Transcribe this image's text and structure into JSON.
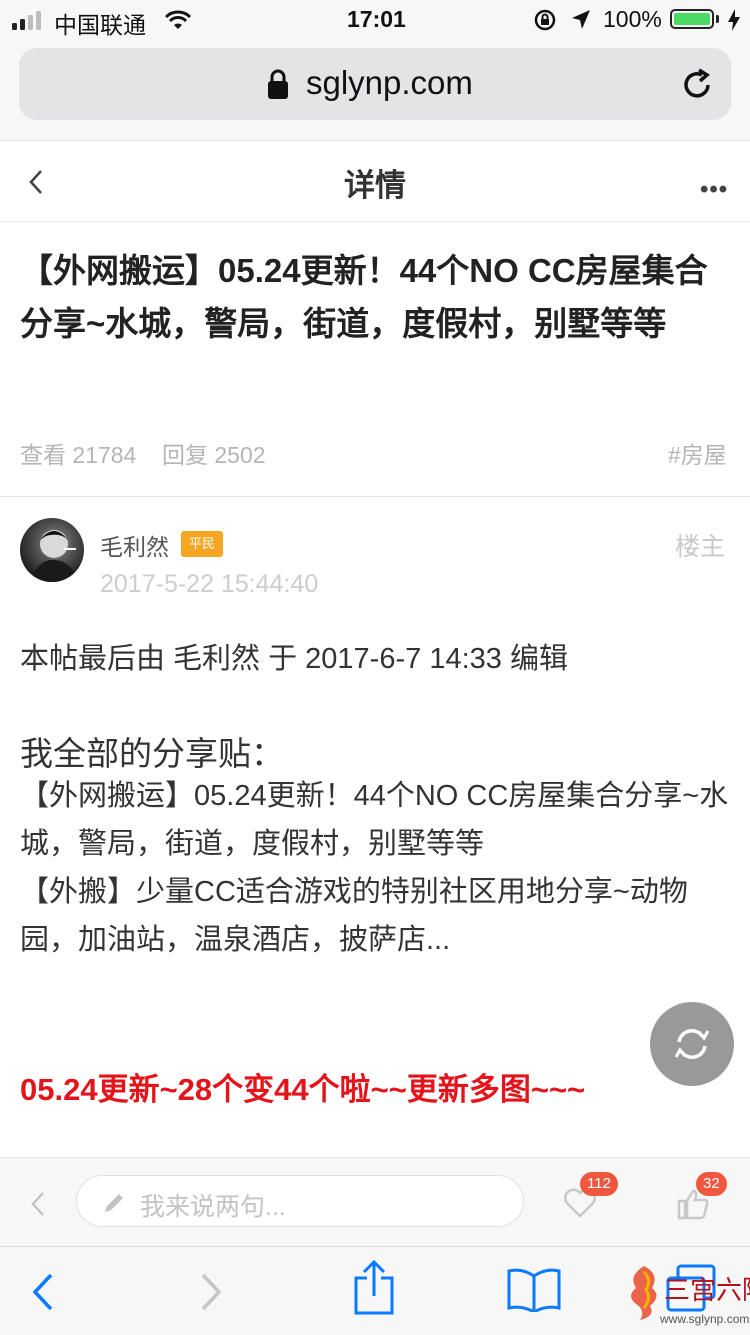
{
  "status_bar": {
    "carrier": "中国联通",
    "time": "17:01",
    "battery": "100%"
  },
  "address_bar": {
    "url": "sglynp.com"
  },
  "header": {
    "title": "详情",
    "more": "•••"
  },
  "post": {
    "title": "【外网搬运】05.24更新！44个NO CC房屋集合分享~水城，警局，街道，度假村，别墅等等",
    "views": "查看 21784",
    "replies": "回复 2502",
    "tag": "#房屋"
  },
  "author": {
    "name": "毛利然",
    "badge": "平民",
    "floor": "楼主",
    "date": "2017-5-22 15:44:40"
  },
  "content": {
    "edit_note": "本帖最后由 毛利然 于 2017-6-7 14:33 编辑",
    "share_heading": "我全部的分享贴：",
    "link_1": "【外网搬运】05.24更新！44个NO CC房屋集合分享~水城，警局，街道，度假村，别墅等等",
    "link_2": "【外搬】少量CC适合游戏的特别社区用地分享~动物园，加油站，温泉酒店，披萨店...",
    "red_update": "05.24更新~28个变44个啦~~更新多图~~~"
  },
  "reply_bar": {
    "placeholder": "我来说两句...",
    "likes": "112",
    "thumbs": "32"
  },
  "watermark": {
    "name": "三宫六院",
    "url": "www.sglynp.com"
  },
  "colors": {
    "accent_blue": "#0a7aff",
    "badge_orange": "#f5a623",
    "update_red": "#e5131a",
    "count_red": "#f0573f",
    "battery_green": "#4cd964"
  }
}
